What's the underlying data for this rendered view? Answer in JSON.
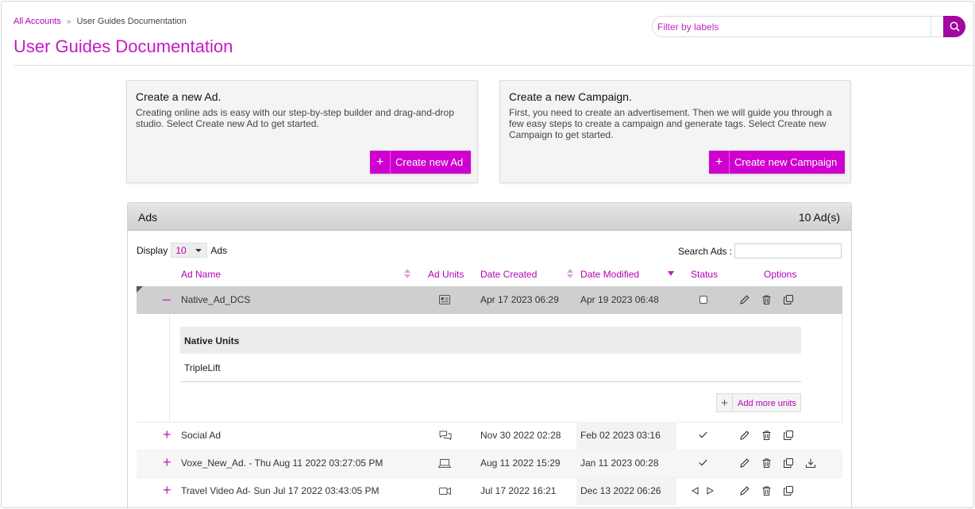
{
  "breadcrumb": {
    "root": "All Accounts",
    "separator": "»",
    "current": "User Guides Documentation"
  },
  "page_title": "User Guides Documentation",
  "filter": {
    "placeholder": "Filter by labels"
  },
  "cards": {
    "ad": {
      "title": "Create a new Ad.",
      "description": "Creating online ads is easy with our step-by-step builder and drag-and-drop studio. Select Create new Ad to get started.",
      "button_label": "Create new Ad"
    },
    "campaign": {
      "title": "Create a new Campaign.",
      "description": "First, you need to create an advertisement. Then we will guide you through a few easy steps to create a campaign and generate tags. Select Create new Campaign to get started.",
      "button_label": "Create new Campaign"
    }
  },
  "ads_panel": {
    "title": "Ads",
    "count": "10 Ad(s)",
    "display_label": "Display",
    "display_value": "10",
    "display_suffix": "Ads",
    "search_label": "Search Ads :",
    "columns": {
      "name": "Ad Name",
      "units": "Ad Units",
      "created": "Date Created",
      "modified": "Date Modified",
      "status": "Status",
      "options": "Options"
    },
    "expanded": {
      "header": "Native Units",
      "value": "TripleLift",
      "add_more_label": "Add more units"
    },
    "rows": [
      {
        "toggle": "–",
        "name": "Native_Ad_DCS",
        "unit_icon": "native-card-icon",
        "created": "Apr 17 2023 06:29",
        "modified": "Apr 19 2023 06:48",
        "status": "checkbox-empty"
      },
      {
        "toggle": "+",
        "name": "Social Ad",
        "unit_icon": "chat-bubbles-icon",
        "created": "Nov 30 2022 02:28",
        "modified": "Feb 02 2023 03:16",
        "status": "checkmark"
      },
      {
        "toggle": "+",
        "name": "Voxe_New_Ad. - Thu Aug 11 2022 03:27:05 PM",
        "unit_icon": "laptop-icon",
        "created": "Aug 11 2022 15:29",
        "modified": "Jan 11 2023 00:28",
        "status": "checkmark"
      },
      {
        "toggle": "+",
        "name": "Travel Video Ad- Sun Jul 17 2022 03:43:05 PM",
        "unit_icon": "video-camera-icon",
        "created": "Jul 17 2022 16:21",
        "modified": "Dec 13 2022 06:26",
        "status": "prev-next"
      }
    ]
  },
  "colors": {
    "accent": "#cf00cf",
    "link": "#b300b3",
    "title": "#c41ac4"
  }
}
